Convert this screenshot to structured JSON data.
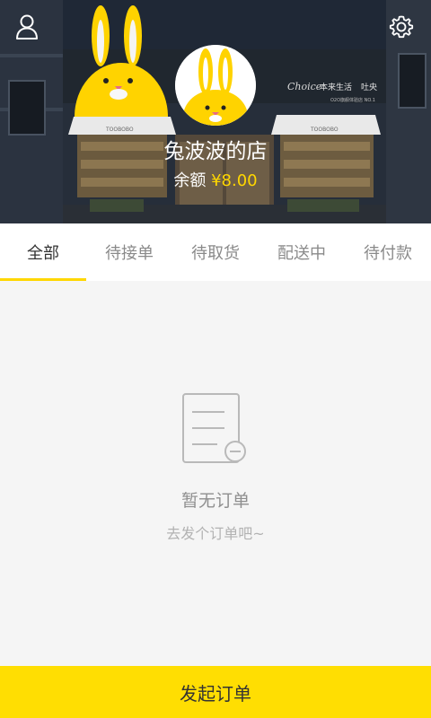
{
  "header": {
    "shop_name": "兔波波的店",
    "balance_label": "余额",
    "balance_amount": "¥8.00",
    "storefront_signs": {
      "brand": "Choice",
      "sign1": "本来生活",
      "sign2": "吐央",
      "sign3": "O2O旗舰体验店 NO.1",
      "awning": "TOOBOBO"
    },
    "icons": {
      "user": "user-icon",
      "settings": "gear-icon",
      "avatar": "rabbit-logo"
    }
  },
  "tabs": [
    {
      "label": "全部",
      "active": true
    },
    {
      "label": "待接单",
      "active": false
    },
    {
      "label": "待取货",
      "active": false
    },
    {
      "label": "配送中",
      "active": false
    },
    {
      "label": "待付款",
      "active": false
    }
  ],
  "empty_state": {
    "icon": "document-icon",
    "title": "暂无订单",
    "subtitle": "去发个订单吧~"
  },
  "bottom_button": {
    "label": "发起订单"
  },
  "colors": {
    "accent": "#ffde02",
    "balance": "#ffd700",
    "tab_active_text": "#333333",
    "tab_inactive_text": "#8a8a8a",
    "page_bg": "#f5f5f5"
  }
}
